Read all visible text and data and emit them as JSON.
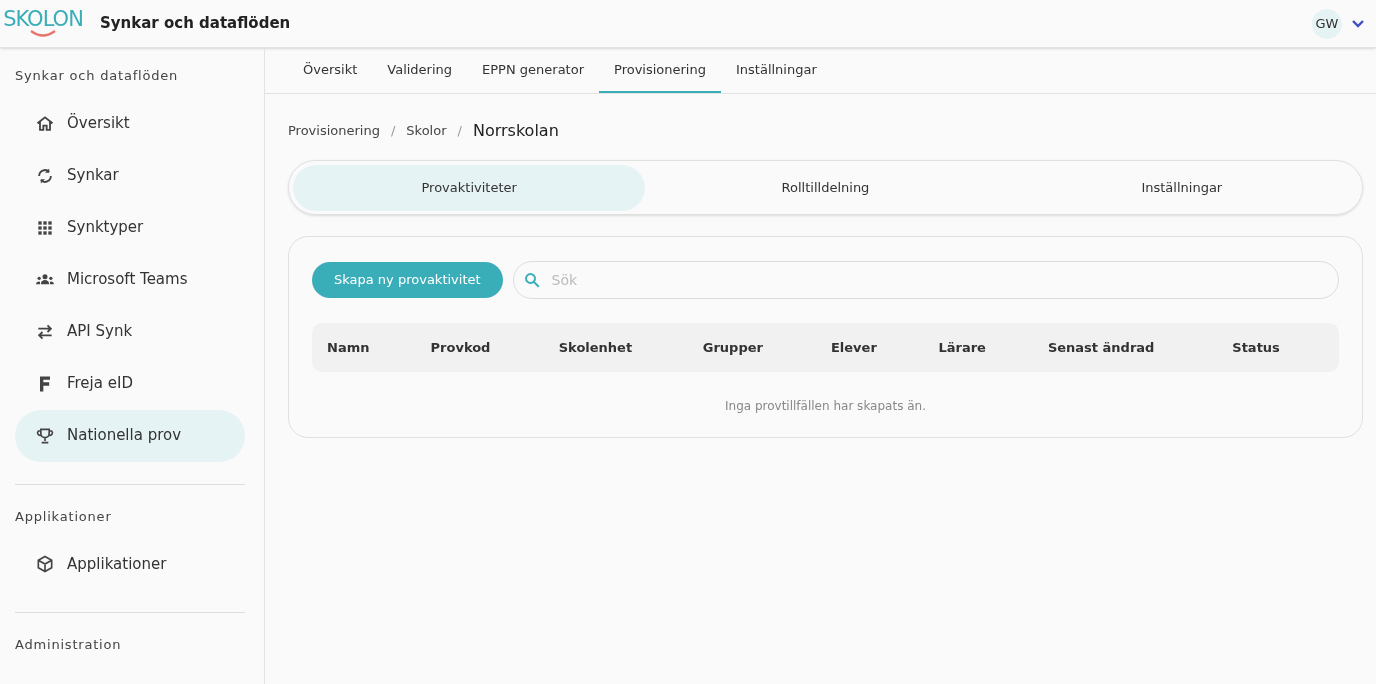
{
  "header": {
    "logo": "SKOLON",
    "title": "Synkar och dataflöden",
    "avatar": "GW"
  },
  "sidebar": {
    "sections": [
      {
        "heading": "Synkar och dataflöden",
        "items": [
          {
            "label": "Översikt",
            "kind": "home",
            "selected": false
          },
          {
            "label": "Synkar",
            "kind": "sync",
            "selected": false
          },
          {
            "label": "Synktyper",
            "kind": "grid",
            "selected": false
          },
          {
            "label": "Microsoft Teams",
            "kind": "people",
            "selected": false
          },
          {
            "label": "API Synk",
            "kind": "swap",
            "selected": false
          },
          {
            "label": "Freja eID",
            "kind": "letter",
            "selected": false
          },
          {
            "label": "Nationella prov",
            "kind": "trophy",
            "selected": true
          }
        ]
      },
      {
        "heading": "Applikationer",
        "items": [
          {
            "label": "Applikationer",
            "kind": "cube",
            "selected": false
          }
        ]
      },
      {
        "heading": "Administration"
      }
    ]
  },
  "tabs": [
    {
      "label": "Översikt",
      "selected": false
    },
    {
      "label": "Validering",
      "selected": false
    },
    {
      "label": "EPPN generator",
      "selected": false
    },
    {
      "label": "Provisionering",
      "selected": true
    },
    {
      "label": "Inställningar",
      "selected": false
    }
  ],
  "breadcrumb": {
    "items": [
      "Provisionering",
      "Skolor",
      "Norrskolan"
    ],
    "separator": "/"
  },
  "subtabs": [
    {
      "label": "Provaktiviteter",
      "selected": true
    },
    {
      "label": "Rolltilldelning",
      "selected": false
    },
    {
      "label": "Inställningar",
      "selected": false
    }
  ],
  "create_button": "Skapa ny provaktivitet",
  "search": {
    "placeholder": "Sök"
  },
  "table": {
    "columns": [
      "Namn",
      "Provkod",
      "Skolenhet",
      "Grupper",
      "Elever",
      "Lärare",
      "Senast ändrad",
      "Status"
    ],
    "empty_message": "Inga provtillfällen har skapats än."
  }
}
